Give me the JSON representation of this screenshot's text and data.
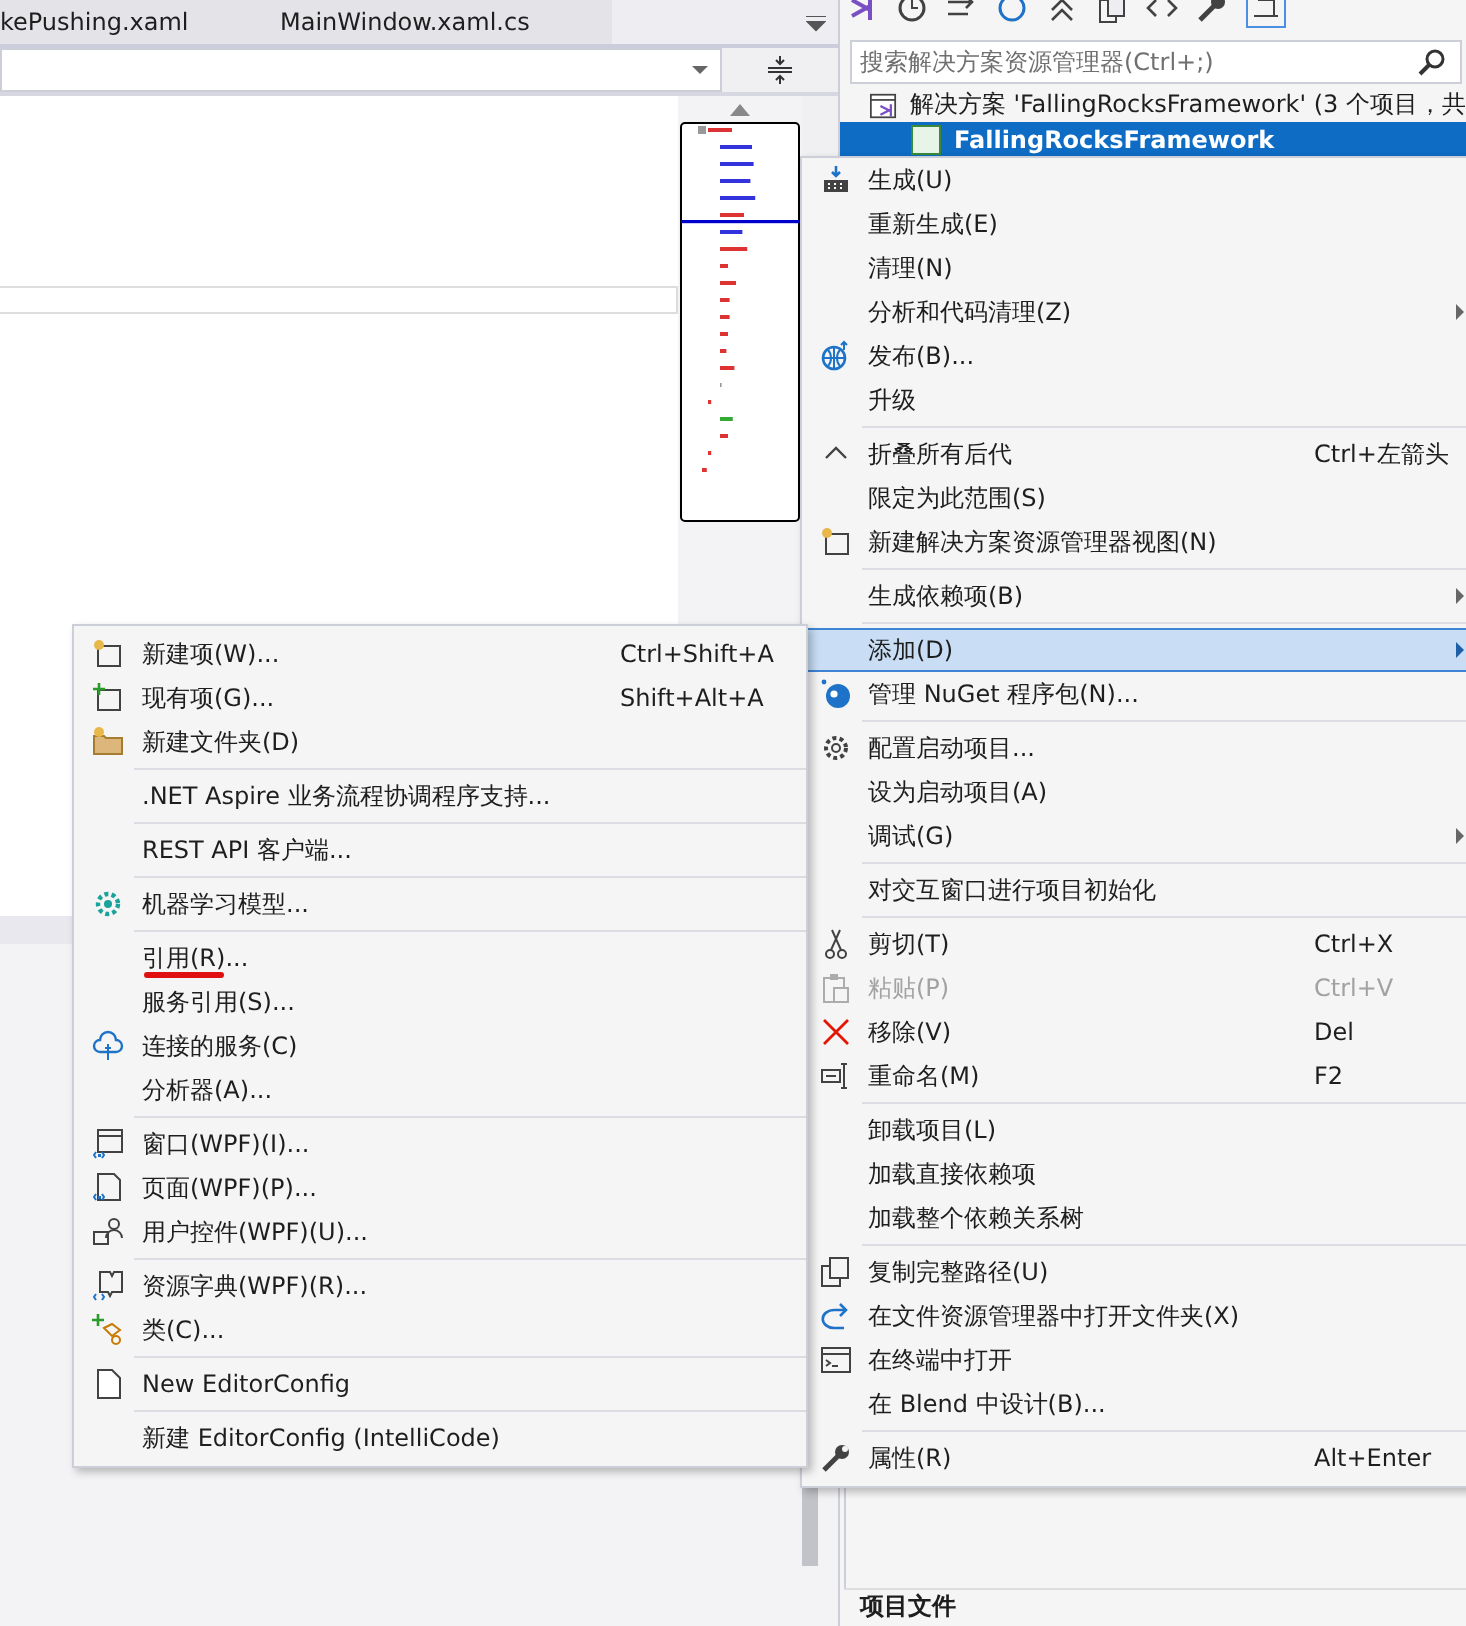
{
  "editor": {
    "tabs": [
      {
        "label": "kePushing.xaml",
        "selected": false
      },
      {
        "label": "MainWindow.xaml.cs",
        "selected": false
      }
    ]
  },
  "solution_explorer": {
    "search": {
      "placeholder": "搜索解决方案资源管理器(Ctrl+;)"
    },
    "tree": [
      {
        "label": "解决方案 'FallingRocksFramework' (3 个项目，共",
        "selected": false
      },
      {
        "label": "FallingRocksFramework",
        "selected": true
      }
    ],
    "properties_header": "项目文件"
  },
  "context_menu": {
    "sections": [
      [
        {
          "label": "生成(U)",
          "submenu": false,
          "disabled": false,
          "selected": false
        },
        {
          "label": "重新生成(E)",
          "submenu": false,
          "disabled": false,
          "selected": false
        },
        {
          "label": "清理(N)",
          "submenu": false,
          "disabled": false,
          "selected": false
        },
        {
          "label": "分析和代码清理(Z)",
          "submenu": true,
          "disabled": false,
          "selected": false
        },
        {
          "label": "发布(B)...",
          "submenu": false,
          "disabled": false,
          "selected": false
        },
        {
          "label": "升级",
          "submenu": false,
          "disabled": false,
          "selected": false
        }
      ],
      [
        {
          "label": "折叠所有后代",
          "shortcut": "Ctrl+左箭头",
          "submenu": false,
          "disabled": false,
          "selected": false
        },
        {
          "label": "限定为此范围(S)",
          "submenu": false,
          "disabled": false,
          "selected": false
        },
        {
          "label": "新建解决方案资源管理器视图(N)",
          "submenu": false,
          "disabled": false,
          "selected": false
        }
      ],
      [
        {
          "label": "生成依赖项(B)",
          "submenu": true,
          "disabled": false,
          "selected": false
        }
      ],
      [
        {
          "label": "添加(D)",
          "submenu": true,
          "disabled": false,
          "selected": true
        },
        {
          "label": "管理 NuGet 程序包(N)...",
          "submenu": false,
          "disabled": false,
          "selected": false
        }
      ],
      [
        {
          "label": "配置启动项目...",
          "submenu": false,
          "disabled": false,
          "selected": false
        },
        {
          "label": "设为启动项目(A)",
          "submenu": false,
          "disabled": false,
          "selected": false
        },
        {
          "label": "调试(G)",
          "submenu": true,
          "disabled": false,
          "selected": false
        }
      ],
      [
        {
          "label": "对交互窗口进行项目初始化",
          "submenu": false,
          "disabled": false,
          "selected": false
        }
      ],
      [
        {
          "label": "剪切(T)",
          "shortcut": "Ctrl+X",
          "submenu": false,
          "disabled": false,
          "selected": false
        },
        {
          "label": "粘贴(P)",
          "shortcut": "Ctrl+V",
          "submenu": false,
          "disabled": true,
          "selected": false
        },
        {
          "label": "移除(V)",
          "shortcut": "Del",
          "submenu": false,
          "disabled": false,
          "selected": false
        },
        {
          "label": "重命名(M)",
          "shortcut": "F2",
          "submenu": false,
          "disabled": false,
          "selected": false
        }
      ],
      [
        {
          "label": "卸载项目(L)",
          "submenu": false,
          "disabled": false,
          "selected": false
        },
        {
          "label": "加载直接依赖项",
          "submenu": false,
          "disabled": false,
          "selected": false
        },
        {
          "label": "加载整个依赖关系树",
          "submenu": false,
          "disabled": false,
          "selected": false
        }
      ],
      [
        {
          "label": "复制完整路径(U)",
          "submenu": false,
          "disabled": false,
          "selected": false
        },
        {
          "label": "在文件资源管理器中打开文件夹(X)",
          "submenu": false,
          "disabled": false,
          "selected": false
        },
        {
          "label": "在终端中打开",
          "submenu": false,
          "disabled": false,
          "selected": false
        },
        {
          "label": "在 Blend 中设计(B)...",
          "submenu": false,
          "disabled": false,
          "selected": false
        }
      ],
      [
        {
          "label": "属性(R)",
          "shortcut": "Alt+Enter",
          "submenu": false,
          "disabled": false,
          "selected": false
        }
      ]
    ]
  },
  "add_submenu": {
    "sections": [
      [
        {
          "label": "新建项(W)...",
          "shortcut": "Ctrl+Shift+A",
          "underlined": false
        },
        {
          "label": "现有项(G)...",
          "shortcut": "Shift+Alt+A",
          "underlined": false
        },
        {
          "label": "新建文件夹(D)",
          "underlined": false
        }
      ],
      [
        {
          "label": ".NET Aspire 业务流程协调程序支持...",
          "underlined": false
        }
      ],
      [
        {
          "label": "REST API 客户端...",
          "underlined": false
        }
      ],
      [
        {
          "label": "机器学习模型...",
          "underlined": false
        }
      ],
      [
        {
          "label": "引用(R)...",
          "underlined": true
        },
        {
          "label": "服务引用(S)...",
          "underlined": false
        },
        {
          "label": "连接的服务(C)",
          "underlined": false
        },
        {
          "label": "分析器(A)...",
          "underlined": false
        }
      ],
      [
        {
          "label": "窗口(WPF)(I)...",
          "underlined": false
        },
        {
          "label": "页面(WPF)(P)...",
          "underlined": false
        },
        {
          "label": "用户控件(WPF)(U)...",
          "underlined": false
        }
      ],
      [
        {
          "label": "资源字典(WPF)(R)...",
          "underlined": false
        },
        {
          "label": "类(C)...",
          "underlined": false
        }
      ],
      [
        {
          "label": "New EditorConfig",
          "underlined": false
        }
      ],
      [
        {
          "label": "新建 EditorConfig (IntelliCode)",
          "underlined": false
        }
      ]
    ]
  }
}
